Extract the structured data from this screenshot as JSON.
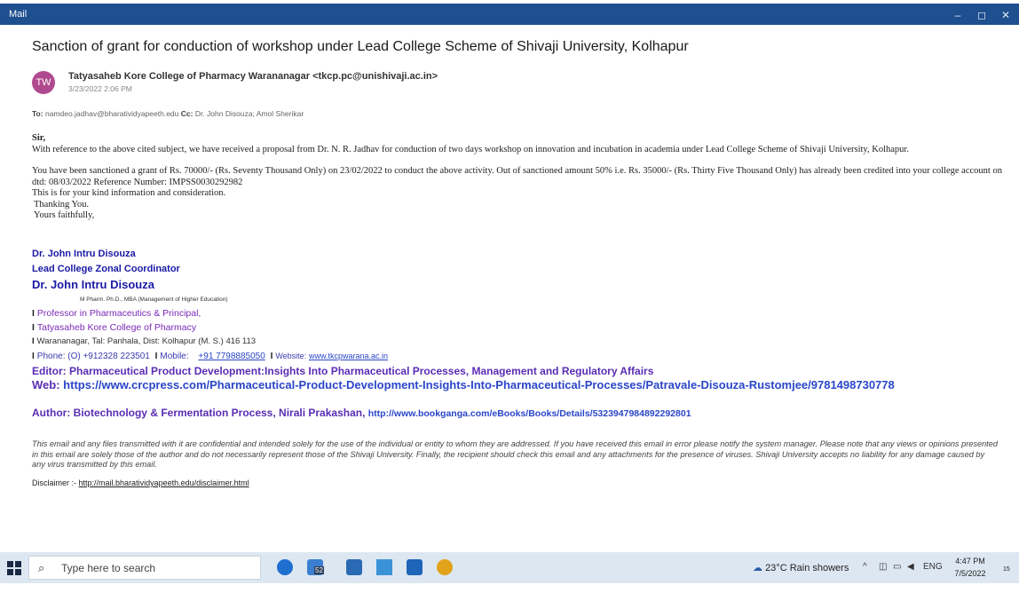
{
  "window": {
    "app_title": "Mail",
    "minimize": "–",
    "maximize": "◻",
    "close": "✕"
  },
  "email": {
    "subject": "Sanction of grant for conduction of workshop under Lead College Scheme of Shivaji University, Kolhapur",
    "avatar_initials": "TW",
    "sender": "Tatyasaheb Kore College of Pharmacy Warananagar <tkcp.pc@unishivaji.ac.in>",
    "sent": "3/23/2022 2:06 PM",
    "to_label": "To:",
    "to": "namdeo.jadhav@bharatividyapeeth.edu",
    "cc_label": "Cc:",
    "cc": "Dr. John Disouza; Amol Sherikar",
    "salutation": "Sir,",
    "para1": "With reference to the above cited subject, we have received a proposal from Dr. N. R. Jadhav for conduction of two days workshop on innovation and incubation in academia under Lead College Scheme of Shivaji University, Kolhapur.",
    "para2": "You have been sanctioned a grant of Rs. 70000/- (Rs. Seventy Thousand Only) on 23/02/2022 to conduct the above activity. Out of sanctioned amount 50% i.e. Rs. 35000/- (Rs. Thirty Five Thousand Only) has already been credited into your college account on dtd: 08/03/2022 Reference Number: IMPSS0030292982",
    "para3": "This is for your kind information and consideration.",
    "thanks": "Thanking You.",
    "closing": "Yours faithfully,"
  },
  "signature": {
    "name1": "Dr. John Intru Disouza",
    "role": "Lead College Zonal Coordinator",
    "name2": "Dr. John Intru Disouza",
    "degrees": "M Pharm. Ph.D., MBA (Management of Higher Education)",
    "bar": "I",
    "position": "Professor in Pharmaceutics & Principal,",
    "college": "Tatyasaheb Kore College of Pharmacy",
    "address": "Warananagar, Tal: Panhala, Dist: Kolhapur (M. S.) 416 113",
    "phone": "Phone: (O) +912328 223501",
    "mobile_label": "Mobile:",
    "mobile": "+91 7798885050",
    "website_label": "Website:",
    "website": "www.tkcpwarana.ac.in",
    "editor": "Editor: Pharmaceutical Product Development:Insights Into Pharmaceutical Processes, Management and Regulatory Affairs",
    "web_label": "Web:",
    "web_url": "https://www.crcpress.com/Pharmaceutical-Product-Development-Insights-Into-Pharmaceutical-Processes/Patravale-Disouza-Rustomjee/9781498730778",
    "author": "Author: Biotechnology & Fermentation Process, Nirali Prakashan,",
    "author_url": "http://www.bookganga.com/eBooks/Books/Details/5323947984892292801"
  },
  "footer": {
    "disclaimer": "This email and any files transmitted with it are confidential and intended solely for the use of the individual or entity to whom they are addressed. If you have received this email in error please notify the system manager. Please note that any views or opinions presented in this email are solely those of the author and do not necessarily represent those of the Shivaji University. Finally, the recipient should check this email and any attachments for the presence of viruses. Shivaji University accepts no liability for any damage caused by any virus transmitted by this email.",
    "disclaimer_label": "Disclaimer :-",
    "disclaimer_url": "http://mail.bharatividyapeeth.edu/disclaimer.html"
  },
  "taskbar": {
    "search_placeholder": "Type here to search",
    "mail_badge": "52",
    "weather": "23°C  Rain showers",
    "lang": "ENG",
    "time": "4:47 PM",
    "date": "7/5/2022",
    "notif_count": "15",
    "colors": {
      "edge": "#1e6fd0",
      "store": "#2a6ab4",
      "mail": "#1e64b8",
      "chrome": "#e2a21b"
    }
  }
}
